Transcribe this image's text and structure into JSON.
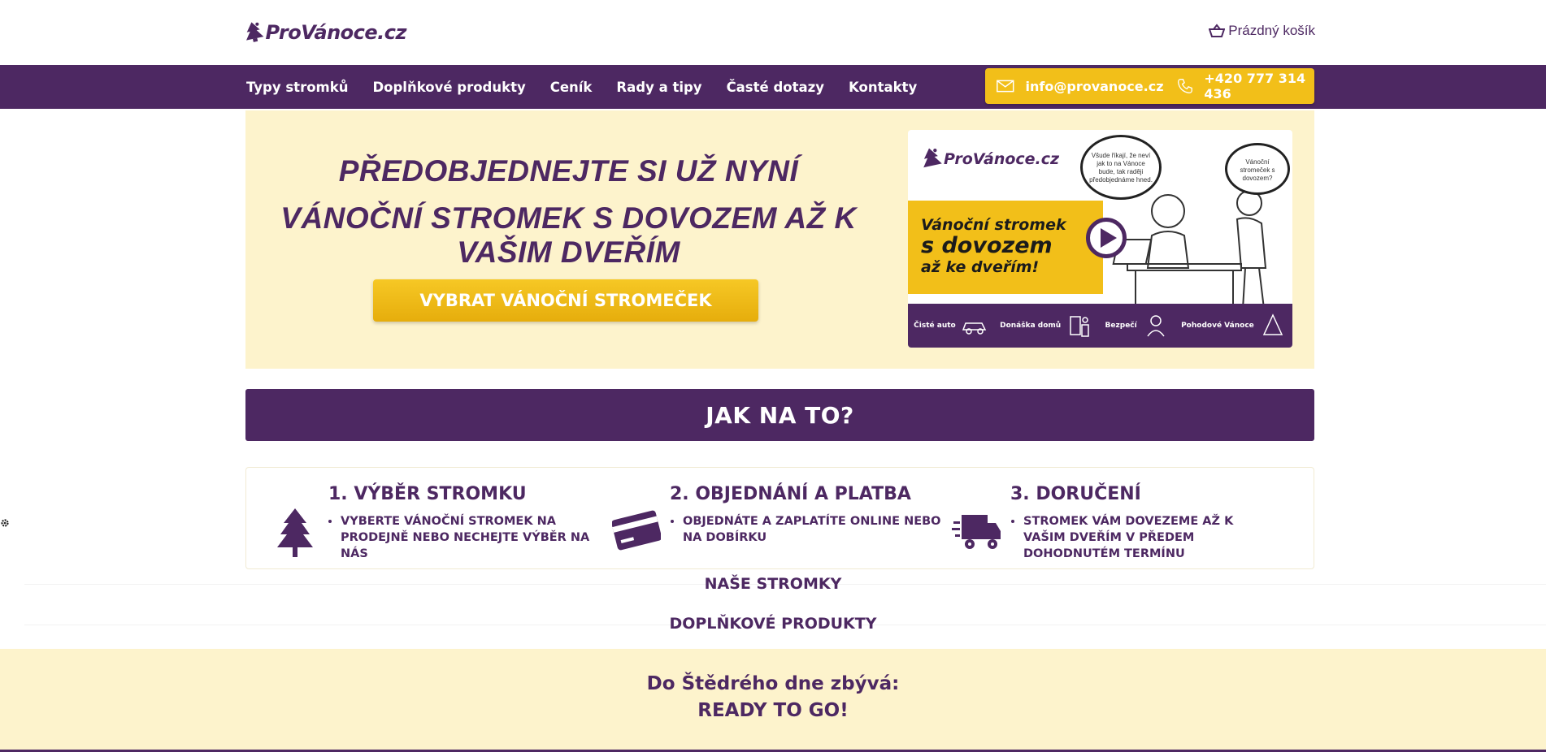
{
  "brand": {
    "logo_text": "ProVánoce.cz",
    "color_primary": "#4d2862",
    "color_accent": "#f2bf19",
    "color_cream": "#fdf3cc"
  },
  "header": {
    "cart_label": "Prázdný košík",
    "cart_icon": "basket-icon"
  },
  "nav": {
    "items": [
      {
        "label": "Typy stromků"
      },
      {
        "label": "Doplňkové produkty"
      },
      {
        "label": "Ceník"
      },
      {
        "label": "Rady a tipy"
      },
      {
        "label": "Časté dotazy"
      },
      {
        "label": "Kontakty"
      }
    ],
    "email": "info@provanoce.cz",
    "phone": "+420 777 314 436"
  },
  "hero": {
    "line1": "PŘEDOBJEDNEJTE SI UŽ NYNÍ",
    "line2": "VÁNOČNÍ STROMEK S DOVOZEM AŽ K VAŠIM DVEŘÍM",
    "button_label": "VYBRAT VÁNOČNÍ STROMEČEK",
    "video": {
      "logo_text": "ProVánoce.cz",
      "title_line1": "Vánoční stromek",
      "title_line2": "s dovozem",
      "title_line3": "až ke dveřím!",
      "bubble_left": "Všude říkají, že neví jak to na Vánoce bude, tak raději předobjednáme hned.",
      "bubble_right": "Vánoční stromeček s dovozem?",
      "strip": [
        "Čisté auto",
        "Donáška domů",
        "Bezpečí",
        "Pohodové Vánoce"
      ]
    }
  },
  "howto": {
    "title": "JAK NA TO?",
    "steps": [
      {
        "title": "1. VÝBĚR STROMKU",
        "icon": "tree-icon",
        "text": "VYBERTE VÁNOČNÍ STROMEK NA PRODEJNĚ NEBO NECHEJTE VÝBĚR NA NÁS"
      },
      {
        "title": "2. OBJEDNÁNÍ A PLATBA",
        "icon": "credit-card-icon",
        "text": "OBJEDNÁTE A ZAPLATÍTE ONLINE NEBO NA DOBÍRKU"
      },
      {
        "title": "3. DORUČENÍ",
        "icon": "delivery-truck-icon",
        "text": "STROMEK VÁM DOVEZEME AŽ K VAŠIM DVEŘÍM V PŘEDEM DOHODNUTÉM TERMÍNU"
      }
    ]
  },
  "sections": {
    "trees": "NAŠE STROMKY",
    "extras": "DOPLŇKOVÉ PRODUKTY"
  },
  "countdown": {
    "label": "Do Štědrého dne zbývá:",
    "value": "READY TO GO!"
  }
}
